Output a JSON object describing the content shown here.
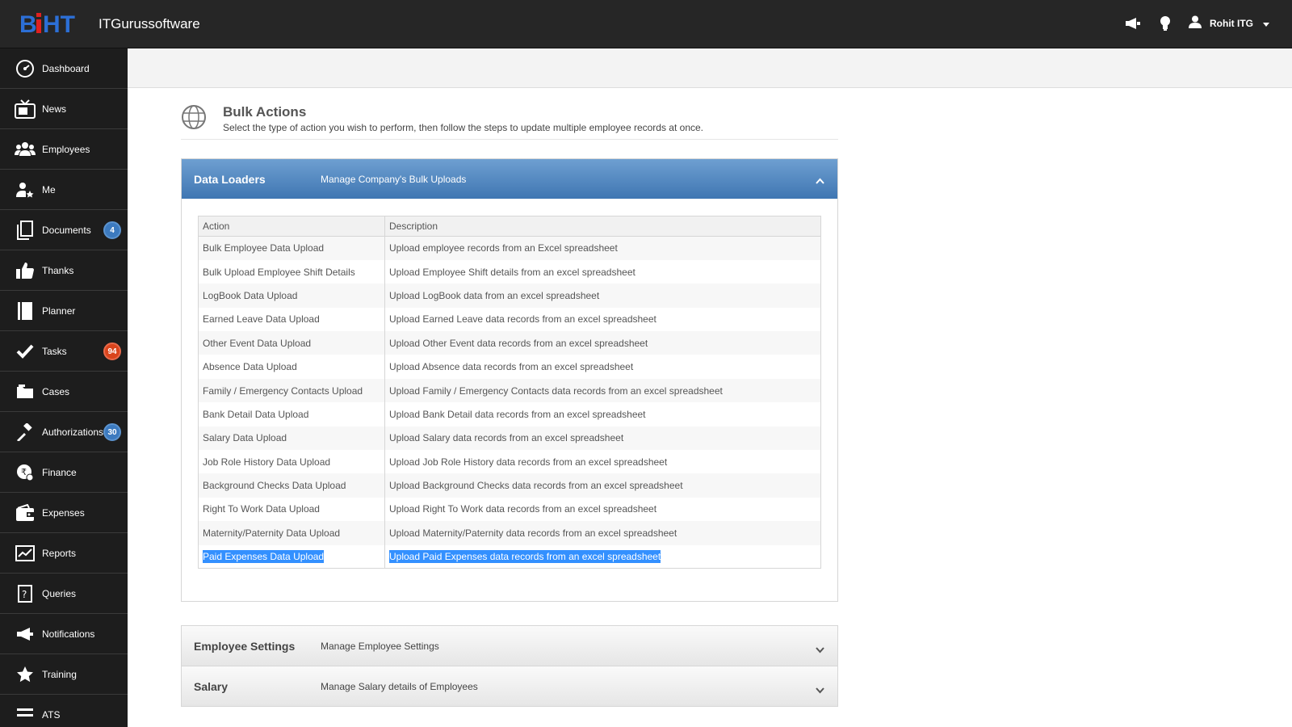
{
  "app": {
    "name": "ITGurussoftware",
    "logo_text": "BiHT"
  },
  "header": {
    "user_name": "Rohit ITG"
  },
  "sidebar": {
    "items": [
      {
        "label": "Dashboard"
      },
      {
        "label": "News"
      },
      {
        "label": "Employees"
      },
      {
        "label": "Me"
      },
      {
        "label": "Documents",
        "badge": "4"
      },
      {
        "label": "Thanks"
      },
      {
        "label": "Planner"
      },
      {
        "label": "Tasks",
        "badge": "94"
      },
      {
        "label": "Cases"
      },
      {
        "label": "Authorizations",
        "badge": "30"
      },
      {
        "label": "Finance"
      },
      {
        "label": "Expenses"
      },
      {
        "label": "Reports"
      },
      {
        "label": "Queries"
      },
      {
        "label": "Notifications"
      },
      {
        "label": "Training"
      },
      {
        "label": "ATS"
      }
    ]
  },
  "page": {
    "title": "Bulk Actions",
    "subtitle": "Select the type of action you wish to perform, then follow the steps to update multiple employee records at once."
  },
  "data_loaders": {
    "title": "Data Loaders",
    "description": "Manage Company's Bulk Uploads",
    "columns": [
      "Action",
      "Description"
    ],
    "rows": [
      {
        "action": "Bulk Employee Data Upload",
        "description": "Upload employee records from an Excel spreadsheet"
      },
      {
        "action": "Bulk Upload Employee Shift Details",
        "description": "Upload Employee Shift details from an excel spreadsheet"
      },
      {
        "action": "LogBook Data Upload",
        "description": "Upload LogBook data from an excel spreadsheet"
      },
      {
        "action": "Earned Leave Data Upload",
        "description": "Upload Earned Leave data records from an excel spreadsheet"
      },
      {
        "action": "Other Event Data Upload",
        "description": "Upload Other Event data records from an excel spreadsheet"
      },
      {
        "action": "Absence Data Upload",
        "description": "Upload Absence data records from an excel spreadsheet"
      },
      {
        "action": "Family / Emergency Contacts Upload",
        "description": "Upload Family / Emergency Contacts data records from an excel spreadsheet"
      },
      {
        "action": "Bank Detail Data Upload",
        "description": "Upload Bank Detail data records from an excel spreadsheet"
      },
      {
        "action": "Salary Data Upload",
        "description": "Upload Salary data records from an excel spreadsheet"
      },
      {
        "action": "Job Role History Data Upload",
        "description": "Upload Job Role History data records from an excel spreadsheet"
      },
      {
        "action": "Background Checks Data Upload",
        "description": "Upload Background Checks data records from an excel spreadsheet"
      },
      {
        "action": "Right To Work Data Upload",
        "description": "Upload Right To Work data records from an excel spreadsheet"
      },
      {
        "action": "Maternity/Paternity Data Upload",
        "description": "Upload Maternity/Paternity data records from an excel spreadsheet"
      },
      {
        "action": "Paid Expenses Data Upload",
        "description": "Upload Paid Expenses data records from an excel spreadsheet"
      }
    ]
  },
  "employee_settings": {
    "title": "Employee Settings",
    "description": "Manage Employee Settings"
  },
  "salary": {
    "title": "Salary",
    "description": "Manage Salary details of Employees"
  },
  "colors": {
    "topbar": "#262626",
    "sidebar": "#1d1d1d",
    "accent": "#3f76b2",
    "badge_blue": "#3c7abf",
    "badge_red": "#d9441c",
    "selection": "#3390ff"
  }
}
